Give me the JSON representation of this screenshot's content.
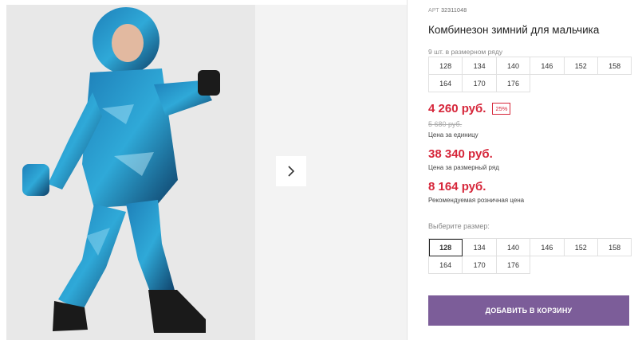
{
  "product": {
    "article_label": "АРТ",
    "article_number": "32311048",
    "title": "Комбинезон зимний для мальчика",
    "pack_note": "9 шт. в размерном ряду",
    "pack_sizes": [
      "128",
      "134",
      "140",
      "146",
      "152",
      "158",
      "164",
      "170",
      "176"
    ]
  },
  "pricing": {
    "unit_price": "4 260 руб.",
    "discount_badge": "25%",
    "old_price": "5 680 руб.",
    "unit_note": "Цена за единицу",
    "pack_price": "38 340 руб.",
    "pack_note": "Цена за размерный ряд",
    "retail_price": "8 164 руб.",
    "retail_note": "Рекомендуемая розничная цена"
  },
  "size_select": {
    "label": "Выберите размер:",
    "selected": "128",
    "options": [
      "128",
      "134",
      "140",
      "146",
      "152",
      "158",
      "164",
      "170",
      "176"
    ]
  },
  "actions": {
    "add_to_cart": "ДОБАВИТЬ В КОРЗИНУ"
  },
  "gallery": {
    "next_icon": "chevron-right-icon"
  },
  "colors": {
    "price_red": "#d6263a",
    "button_purple": "#7c5d99"
  }
}
